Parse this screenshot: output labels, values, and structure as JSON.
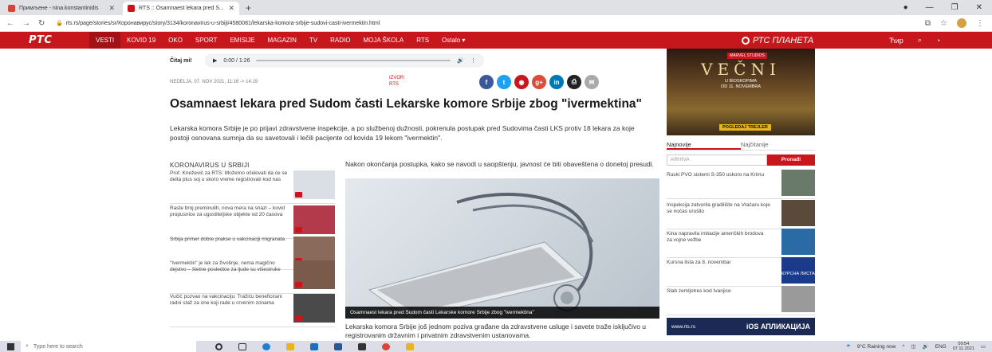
{
  "browser": {
    "tabs": [
      {
        "label": "Примљене - nina.konstantinidis",
        "active": false,
        "color": "#d14836"
      },
      {
        "label": "RTS :: Osamnaest lekara pred S...",
        "active": true,
        "color": "#c8161d"
      }
    ],
    "url": "rts.rs/page/stories/sr/Коронавирус/story/3134/koronavirus-u-srbiji/4580081/lekarska-komora-srbije-sudovi-casti-ivermektin.html"
  },
  "site": {
    "logo": "РТС",
    "nav": [
      "VESTI",
      "KOVID 19",
      "OKO",
      "SPORT",
      "EMISIJE",
      "MAGAZIN",
      "TV",
      "RADIO",
      "MOJA ŠKOLA",
      "RTS",
      "Ostalo ▾"
    ],
    "planeta_label": "РТС ПЛАНЕТА",
    "script_toggle": "Ћир"
  },
  "audio": {
    "label": "Čitaj mi!",
    "time": "0:00 / 1:26"
  },
  "article": {
    "date": "NEDELJA, 07. NOV 2021, 11:16 -> 14:19",
    "source_label": "IZVOR:",
    "source": "RTS",
    "title": "Osamnaest lekara pred Sudom časti Lekarske komore Srbije zbog \"ivermektina\"",
    "lead": "Lekarska komora Srbije je po prijavi zdravstvene inspekcije, a po službenoj dužnosti, pokrenula postupak pred Sudovima časti LKS protiv 18 lekara za koje postoji osnovana sumnja da su savetovali i lečili pacijente od kovida 19 lekom \"ivermektin\".",
    "para1": "Nakon okončanja postupka, kako se navodi u saopštenju, javnost će biti obaveštena o donetoj presudi.",
    "caption": "Osamnaest lekara pred Sudom časti Lekarske komore Srbije zbog \"ivermektina\"",
    "para2": "Lekarska komora Srbije još jednom poziva građane da zdravstvene usluge i savete traže isključivo u registrovanim državnim i privatnim zdravstvenim ustanovama."
  },
  "share_buttons": [
    {
      "label": "f",
      "color": "#3b5998"
    },
    {
      "label": "t",
      "color": "#1da1f2"
    },
    {
      "label": "◉",
      "color": "#c8161d"
    },
    {
      "label": "g+",
      "color": "#dd4b39"
    },
    {
      "label": "in",
      "color": "#0077b5"
    },
    {
      "label": "⎙",
      "color": "#222"
    },
    {
      "label": "✉",
      "color": "#aaa"
    }
  ],
  "sidebar": {
    "heading": "KORONAVIRUS U SRBIJI",
    "items": [
      {
        "text": "Prof. Knežević za RTS: Možemo očekivati da će se delta plus soj u skoro vreme registrovati kod nas",
        "color": "#d9dfe4"
      },
      {
        "text": "Raste broj preminulih, nova mera na snazi – kovid propusnice za ugostiteljske objekte od 20 časova",
        "color": "#b23a4a"
      },
      {
        "text": "Srbija primer dobre prakse u vakcinaciji migranata",
        "color": "#8a6a5a"
      },
      {
        "text": "\"Ivermektin\" je lek za životinje, nema magično dejstvo – štetne posledice za ljude su višestruke",
        "color": "#7a5a4a"
      },
      {
        "text": "Vučić pozvao na vakcinaciju: Tražiću beneficirani radni staž za one koji rade u crvenim zonama",
        "color": "#4a4a4a"
      }
    ]
  },
  "right": {
    "ad": {
      "studio": "MARVEL STUDIOS",
      "movie": "VEČNI",
      "line1": "U BIOSKOPIMA",
      "line2": "OD 11. NOVEMBRA",
      "button": "POGLEDAJ TREJLER"
    },
    "tabs": [
      "Najnovije",
      "Najčitanije"
    ],
    "archive_placeholder": "ARHIVA",
    "archive_button": "Pronađi",
    "items": [
      {
        "text": "Ruski PVO sistemi S-350 uskoro na Krimu",
        "color": "#6a7a6a"
      },
      {
        "text": "Inspekcija zatvorila gradilište na Vračaru koje se noćas urušilo",
        "color": "#5a4a3a"
      },
      {
        "text": "Kina napravila imitacije američkih brodova za vojne vežbe",
        "color": "#2a6aa5"
      },
      {
        "text": "Kursna lista za 8. novembar",
        "color": "#1a3a8a"
      },
      {
        "text": "Slab zemljotres kod Ivanjice",
        "color": "#9a9a9a"
      }
    ],
    "kursna_thumb": "КУРСНА ЛИСТА",
    "app_ad": {
      "url": "www.rts.rs",
      "text": "iOS АПЛИКАЦИЈА"
    }
  },
  "taskbar": {
    "search_placeholder": "Type here to search",
    "weather": "9°C Raining now",
    "lang": "ENG",
    "time": "09:54",
    "date": "07.11.2021"
  }
}
